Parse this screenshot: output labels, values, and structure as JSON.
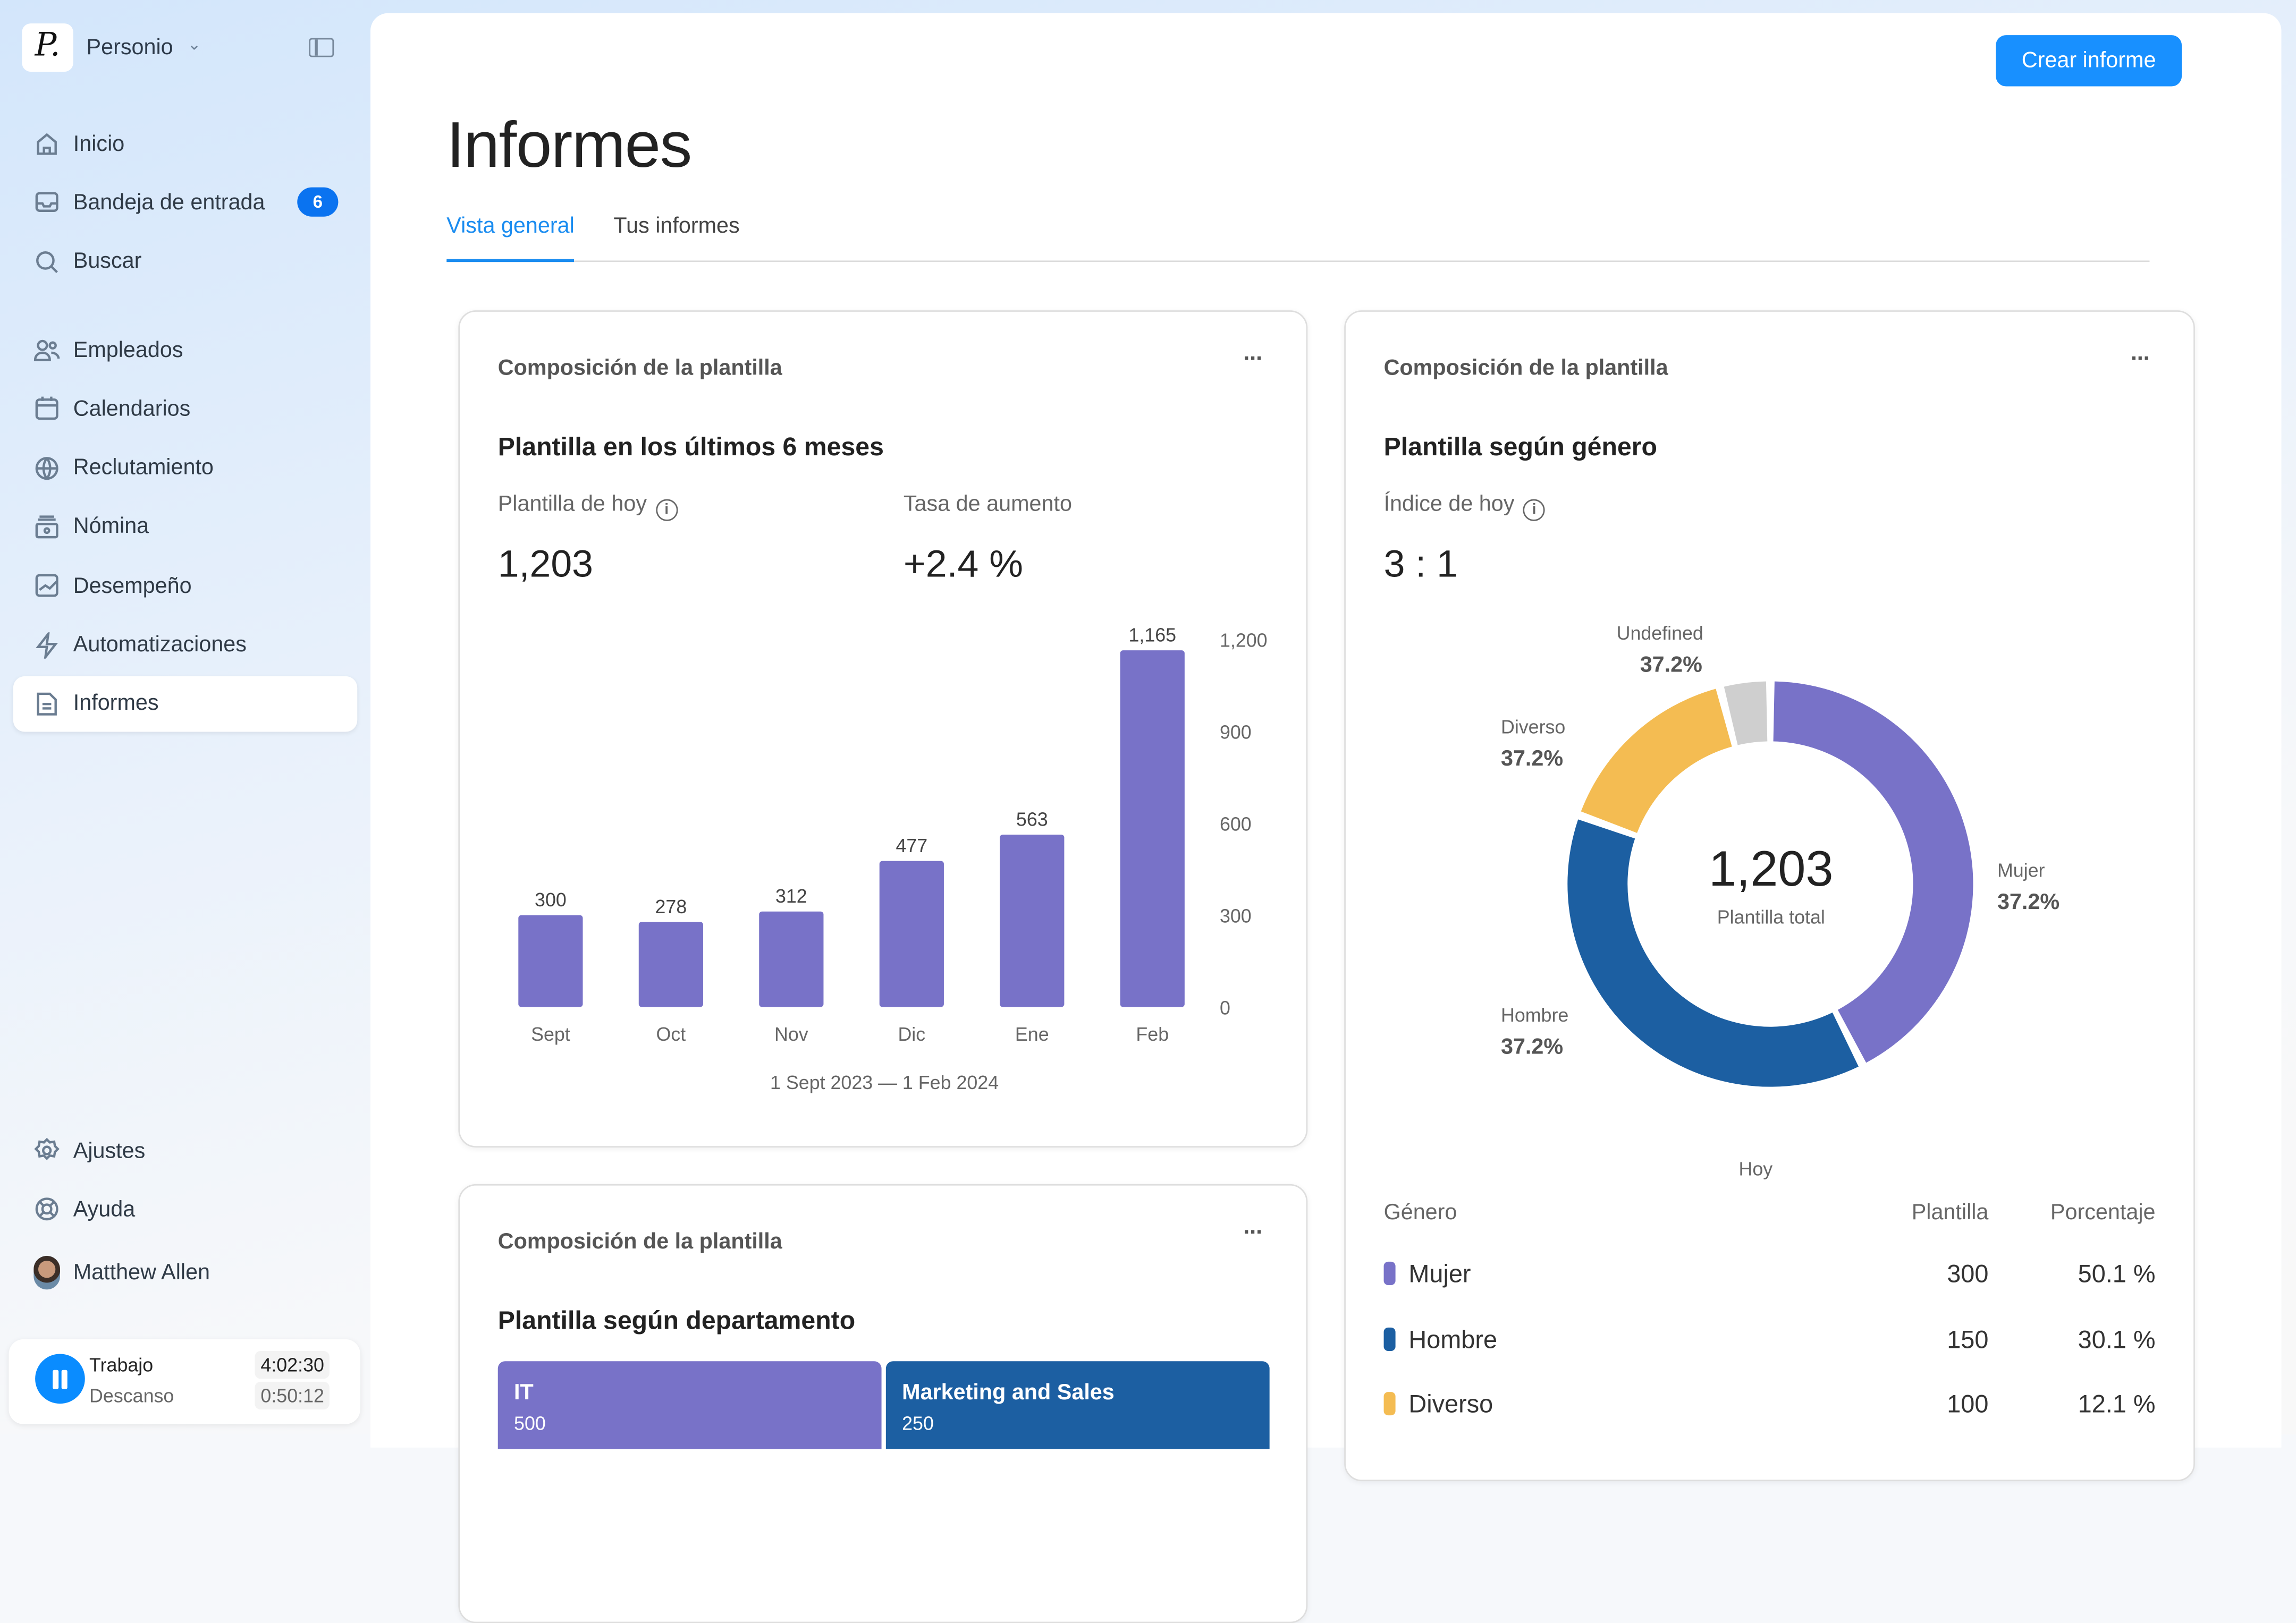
{
  "sidebar": {
    "org": "Personio",
    "logo_text": "P.",
    "primary": [
      {
        "label": "Inicio",
        "icon": "home-icon"
      },
      {
        "label": "Bandeja de entrada",
        "icon": "inbox-icon",
        "badge": "6"
      },
      {
        "label": "Buscar",
        "icon": "search-icon"
      }
    ],
    "secondary": [
      {
        "label": "Empleados",
        "icon": "users-icon"
      },
      {
        "label": "Calendarios",
        "icon": "calendar-icon"
      },
      {
        "label": "Reclutamiento",
        "icon": "globe-icon"
      },
      {
        "label": "Nómina",
        "icon": "payroll-icon"
      },
      {
        "label": "Desempeño",
        "icon": "performance-icon"
      },
      {
        "label": "Automatizaciones",
        "icon": "lightning-icon"
      },
      {
        "label": "Informes",
        "icon": "report-icon",
        "active": true
      }
    ],
    "bottom": [
      {
        "label": "Ajustes",
        "icon": "gear-icon"
      },
      {
        "label": "Ayuda",
        "icon": "lifebuoy-icon"
      }
    ],
    "user": "Matthew Allen",
    "timer": {
      "work_label": "Trabajo",
      "work_time": "4:02:30",
      "break_label": "Descanso",
      "break_time": "0:50:12"
    }
  },
  "header": {
    "title": "Informes",
    "create_button": "Crear informe",
    "tabs": [
      {
        "label": "Vista general",
        "active": true
      },
      {
        "label": "Tus informes"
      }
    ]
  },
  "colors": {
    "accent": "#1890ff",
    "purple": "#7872c8",
    "blue": "#1c5fa2",
    "yellow": "#f4bc52",
    "grey": "#cfcfcf"
  },
  "card1": {
    "title": "Composición de la plantilla",
    "menu": "···",
    "subtitle": "Plantilla en los últimos 6 meses",
    "kpi1_label": "Plantilla de hoy",
    "kpi1_value": "1,203",
    "kpi2_label": "Tasa de aumento",
    "kpi2_value": "+2.4 %",
    "range": "1 Sept 2023 — 1 Feb 2024"
  },
  "card2": {
    "title": "Composición de la plantilla",
    "menu": "···",
    "subtitle": "Plantilla según género",
    "kpi_label": "Índice de hoy",
    "kpi_value": "3 : 1",
    "center_value": "1,203",
    "center_label": "Plantilla total",
    "axis_label": "Hoy",
    "table": {
      "headers": [
        "Género",
        "Plantilla",
        "Porcentaje"
      ],
      "rows": [
        {
          "name": "Mujer",
          "count": "300",
          "pct": "50.1 %",
          "color": "#7872c8"
        },
        {
          "name": "Hombre",
          "count": "150",
          "pct": "30.1 %",
          "color": "#1c5fa2"
        },
        {
          "name": "Diverso",
          "count": "100",
          "pct": "12.1 %",
          "color": "#f4bc52"
        }
      ]
    }
  },
  "card3": {
    "title": "Composición de la plantilla",
    "menu": "···",
    "subtitle": "Plantilla según departamento",
    "tiles": [
      {
        "name": "IT",
        "value": "500",
        "color": "#7872c8"
      },
      {
        "name": "Marketing and Sales",
        "value": "250",
        "color": "#1c5fa2"
      }
    ]
  },
  "chart_data": [
    {
      "type": "bar",
      "categories": [
        "Sept",
        "Oct",
        "Nov",
        "Dic",
        "Ene",
        "Feb"
      ],
      "values": [
        300,
        278,
        312,
        477,
        563,
        1165
      ],
      "data_labels": [
        "300",
        "278",
        "312",
        "477",
        "563",
        "1,165"
      ],
      "ylim": [
        0,
        1200
      ],
      "yticks": [
        "0",
        "300",
        "600",
        "900",
        "1,200"
      ],
      "ytick_values": [
        0,
        300,
        600,
        900,
        1200
      ],
      "yaxis_position": "right",
      "grid": false,
      "color": "#7872c8",
      "xlabel": "1 Sept 2023 — 1 Feb 2024"
    },
    {
      "type": "pie",
      "donut": true,
      "segments": [
        {
          "name": "Mujer",
          "label": "37.2%",
          "share": 0.425,
          "color": "#7872c8"
        },
        {
          "name": "Hombre",
          "label": "37.2%",
          "share": 0.38,
          "color": "#1c5fa2"
        },
        {
          "name": "Diverso",
          "label": "37.2%",
          "share": 0.155,
          "color": "#f4bc52"
        },
        {
          "name": "Undefined",
          "label": "37.2%",
          "share": 0.04,
          "color": "#cfcfcf"
        }
      ]
    }
  ]
}
